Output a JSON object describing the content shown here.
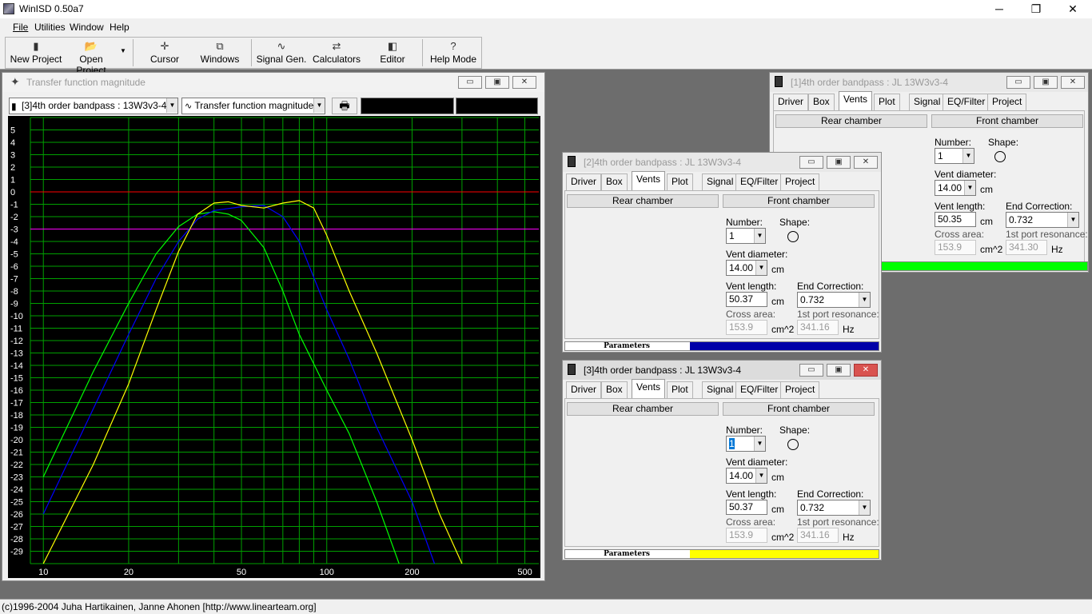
{
  "app": {
    "title": "WinISD 0.50a7",
    "window_controls": {
      "minimize": "─",
      "restore": "❐",
      "close": "✕"
    }
  },
  "menu": [
    "File",
    "Utilities",
    "Window",
    "Help"
  ],
  "toolbar": [
    {
      "label": "New Project",
      "icon": "new-project-icon"
    },
    {
      "label": "Open Project",
      "icon": "open-project-icon"
    },
    {
      "label": "Cursor",
      "icon": "cursor-icon"
    },
    {
      "label": "Windows",
      "icon": "windows-icon"
    },
    {
      "label": "Signal Gen.",
      "icon": "signal-gen-icon"
    },
    {
      "label": "Calculators",
      "icon": "calculators-icon"
    },
    {
      "label": "Editor",
      "icon": "editor-icon"
    },
    {
      "label": "Help Mode",
      "icon": "help-mode-icon"
    }
  ],
  "status": "(c)1996-2004 Juha Hartikainen, Janne Ahonen [http://www.linearteam.org]",
  "graph_window": {
    "title": "Transfer function magnitude",
    "project_select": "[3]4th order bandpass : 13W3v3-4",
    "plot_select": "Transfer function magnitude",
    "chart_data": {
      "type": "line",
      "xscale": "log",
      "xlim": [
        9,
        560
      ],
      "ylim": [
        -30,
        6
      ],
      "x_ticks": [
        10,
        20,
        50,
        100,
        200,
        500
      ],
      "y_ticks": [
        5,
        4,
        3,
        2,
        1,
        0,
        -1,
        -2,
        -3,
        -4,
        -5,
        -6,
        -7,
        -8,
        -9,
        -10,
        -11,
        -12,
        -13,
        -14,
        -15,
        -16,
        -17,
        -18,
        -19,
        -20,
        -21,
        -22,
        -23,
        -24,
        -25,
        -26,
        -27,
        -28,
        -29
      ],
      "background": "#000000",
      "grid_color": "#00a000",
      "reference_lines": [
        {
          "y": 0,
          "color": "#ff0000"
        },
        {
          "y": -3,
          "color": "#ff00ff"
        }
      ],
      "series": [
        {
          "color": "#00ff00",
          "points": [
            [
              10,
              -23
            ],
            [
              15,
              -14.5
            ],
            [
              20,
              -9
            ],
            [
              25,
              -5
            ],
            [
              30,
              -2.8
            ],
            [
              35,
              -1.8
            ],
            [
              40,
              -1.6
            ],
            [
              45,
              -1.8
            ],
            [
              50,
              -2.3
            ],
            [
              60,
              -4.5
            ],
            [
              70,
              -8
            ],
            [
              80,
              -11.5
            ],
            [
              100,
              -16
            ],
            [
              120,
              -19.5
            ],
            [
              150,
              -25
            ],
            [
              180,
              -30
            ]
          ]
        },
        {
          "color": "#0000ff",
          "points": [
            [
              10,
              -26
            ],
            [
              15,
              -17.5
            ],
            [
              20,
              -11.5
            ],
            [
              25,
              -7
            ],
            [
              30,
              -4
            ],
            [
              35,
              -2.2
            ],
            [
              40,
              -1.5
            ],
            [
              50,
              -1.2
            ],
            [
              60,
              -1.1
            ],
            [
              70,
              -2
            ],
            [
              80,
              -4
            ],
            [
              100,
              -9.5
            ],
            [
              120,
              -13.5
            ],
            [
              150,
              -19
            ],
            [
              200,
              -25
            ],
            [
              240,
              -30
            ]
          ]
        },
        {
          "color": "#ffff00",
          "points": [
            [
              10,
              -30
            ],
            [
              15,
              -22
            ],
            [
              20,
              -15.5
            ],
            [
              25,
              -9.5
            ],
            [
              30,
              -4.8
            ],
            [
              35,
              -1.8
            ],
            [
              40,
              -0.9
            ],
            [
              45,
              -0.8
            ],
            [
              50,
              -1.1
            ],
            [
              60,
              -1.3
            ],
            [
              70,
              -0.9
            ],
            [
              80,
              -0.7
            ],
            [
              90,
              -1.3
            ],
            [
              100,
              -3.5
            ],
            [
              120,
              -8
            ],
            [
              150,
              -13
            ],
            [
              200,
              -20
            ],
            [
              250,
              -26
            ],
            [
              300,
              -30
            ]
          ]
        }
      ]
    }
  },
  "tabs": [
    "Driver",
    "Box",
    "Vents",
    "Plot",
    "Signal",
    "EQ/Filter",
    "Project"
  ],
  "labels": {
    "rear_chamber": "Rear chamber",
    "front_chamber": "Front chamber",
    "number": "Number:",
    "shape": "Shape:",
    "vent_diameter": "Vent diameter:",
    "vent_length": "Vent length:",
    "end_correction": "End Correction:",
    "cross_area": "Cross area:",
    "first_port_resonance": "1st port resonance:",
    "cm": "cm",
    "cm2": "cm^2",
    "hz": "Hz",
    "parameters": "Parameters"
  },
  "projects": [
    {
      "title": "[1]4th order bandpass : JL 13W3v3-4",
      "number": "1",
      "vent_diameter": "14.00",
      "vent_length": "50.35",
      "end_correction": "0.732",
      "cross_area": "153.9",
      "port_resonance": "341.30",
      "color": "#00ff00"
    },
    {
      "title": "[2]4th order bandpass : JL 13W3v3-4",
      "number": "1",
      "vent_diameter": "14.00",
      "vent_length": "50.37",
      "end_correction": "0.732",
      "cross_area": "153.9",
      "port_resonance": "341.16",
      "color": "#0000a8"
    },
    {
      "title": "[3]4th order bandpass : JL 13W3v3-4",
      "number": "1",
      "vent_diameter": "14.00",
      "vent_length": "50.37",
      "end_correction": "0.732",
      "cross_area": "153.9",
      "port_resonance": "341.16",
      "color": "#ffff00"
    }
  ]
}
